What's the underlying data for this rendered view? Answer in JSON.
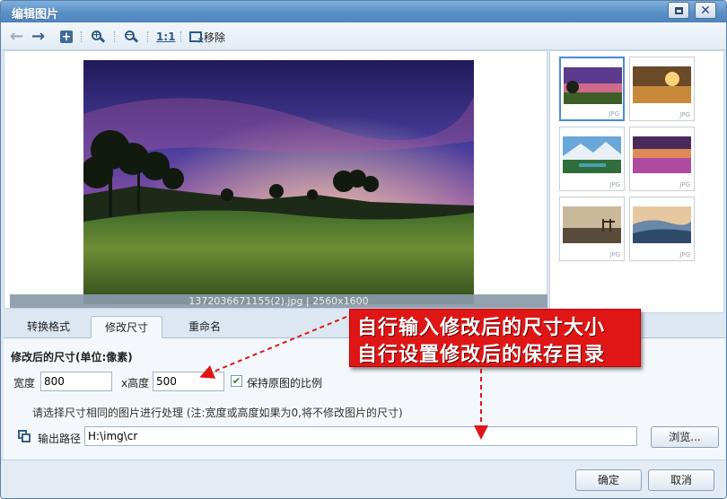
{
  "window": {
    "title": "编辑图片"
  },
  "toolbar": {
    "back_icon": "arrow-left-icon",
    "forward_icon": "arrow-right-icon",
    "add_icon": "plus-box-icon",
    "zoom_in_icon": "zoom-in-icon",
    "zoom_out_icon": "zoom-out-icon",
    "actual_size_label": "1:1",
    "remove_label": "移除"
  },
  "preview": {
    "caption": "1372036671155(2).jpg | 2560x1600"
  },
  "thumbnails": [
    {
      "format": "JPG",
      "selected": true
    },
    {
      "format": "JPG",
      "selected": false
    },
    {
      "format": "JPG",
      "selected": false
    },
    {
      "format": "JPG",
      "selected": false
    },
    {
      "format": "JPG",
      "selected": false
    },
    {
      "format": "JPG",
      "selected": false
    }
  ],
  "tabs": [
    {
      "label": "转换格式",
      "active": false
    },
    {
      "label": "修改尺寸",
      "active": true
    },
    {
      "label": "重命名",
      "active": false
    }
  ],
  "resize": {
    "section_title": "修改后的尺寸(单位:像素)",
    "width_label": "宽度",
    "width_value": "800",
    "height_label": "x高度",
    "height_value": "500",
    "keep_ratio_label": "保持原图的比例",
    "keep_ratio_checked": true,
    "hint": "请选择尺寸相同的图片进行处理 (注:宽度或高度如果为0,将不修改图片的尺寸)",
    "output_label": "输出路径",
    "output_value": "H:\\img\\cr",
    "browse_label": "浏览..."
  },
  "footer": {
    "ok_label": "确定",
    "cancel_label": "取消"
  },
  "annotation": {
    "line1": "自行输入修改后的尺寸大小",
    "line2": "自行设置修改后的保存目录",
    "color": "#e01616"
  }
}
